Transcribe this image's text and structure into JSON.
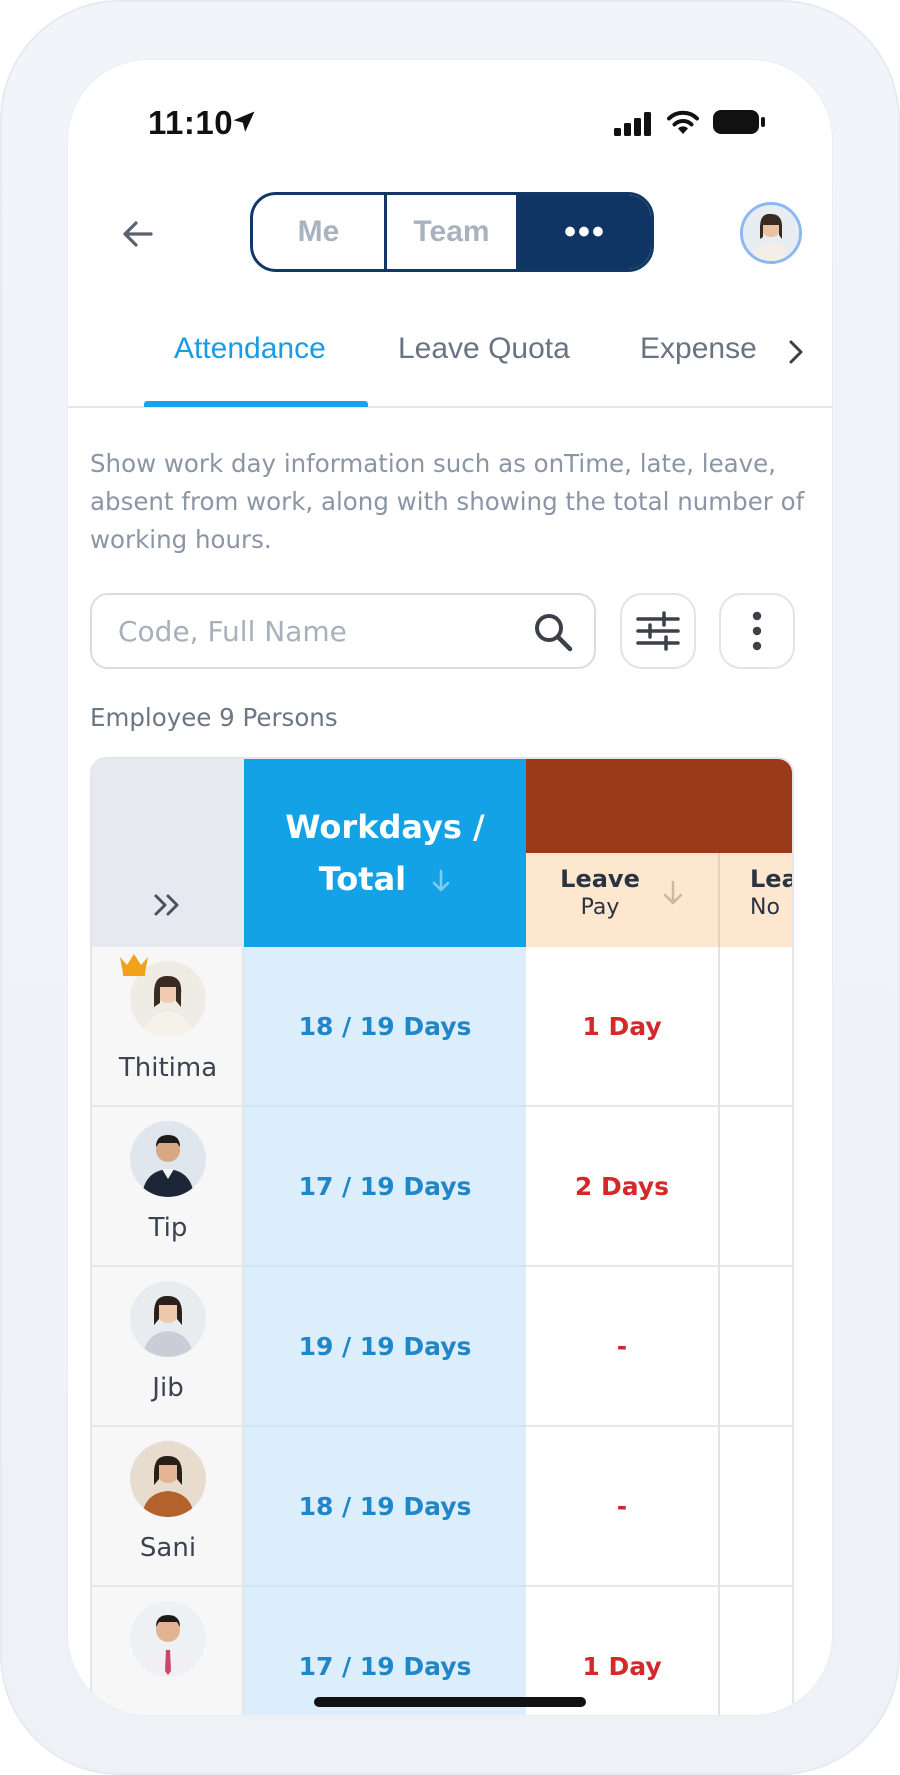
{
  "status_bar": {
    "time": "11:10"
  },
  "header": {
    "segments": [
      {
        "label": "Me"
      },
      {
        "label": "Team"
      },
      {
        "label": "•••"
      }
    ]
  },
  "tabs": [
    {
      "label": "Attendance",
      "active": true
    },
    {
      "label": "Leave Quota",
      "active": false
    },
    {
      "label": "Expense",
      "active": false
    }
  ],
  "description": "Show work day information such as onTime, late, leave, absent from work, along with showing the total number of working hours.",
  "search": {
    "placeholder": "Code, Full Name",
    "value": ""
  },
  "employee_count": "Employee 9 Persons",
  "table": {
    "columns": {
      "workdays_line1": "Workdays /",
      "workdays_line2": "Total",
      "leave_pay_title": "Leave",
      "leave_pay_sub": "Pay",
      "leave_no_title": "Leave",
      "leave_no_sub": "No"
    },
    "rows": [
      {
        "name": "Thitima",
        "workdays": "18 / 19 Days",
        "leave_pay": "1 Day",
        "leader": true
      },
      {
        "name": "Tip",
        "workdays": "17 / 19 Days",
        "leave_pay": "2 Days",
        "leader": false
      },
      {
        "name": "Jib",
        "workdays": "19 / 19 Days",
        "leave_pay": "-",
        "leader": false
      },
      {
        "name": "Sani",
        "workdays": "18 / 19 Days",
        "leave_pay": "-",
        "leader": false
      },
      {
        "name": "",
        "workdays": "17 / 19 Days",
        "leave_pay": "1 Day",
        "leader": false
      }
    ]
  },
  "colors": {
    "primary_navy": "#0f3563",
    "accent_blue": "#13a2e6",
    "group_header_brown": "#9b3a19",
    "leave_header_bg": "#fde8cf",
    "leave_value_red": "#d5282b",
    "workdays_value_blue": "#1f86c8"
  }
}
